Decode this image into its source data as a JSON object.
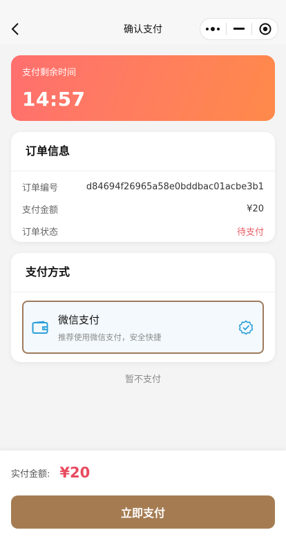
{
  "nav": {
    "title": "确认支付",
    "back_icon": "chevron-left-icon",
    "capsule_icons": [
      "more-dots-icon",
      "minimize-icon",
      "target-close-icon"
    ]
  },
  "timer": {
    "label": "支付剩余时间",
    "value": "14:57"
  },
  "order": {
    "title": "订单信息",
    "rows": [
      {
        "label": "订单编号",
        "value": "d84694f26965a58e0bddbac01acbe3b1"
      },
      {
        "label": "支付金额",
        "value": "¥20"
      },
      {
        "label": "订单状态",
        "value": "待支付"
      }
    ]
  },
  "payment": {
    "title": "支付方式",
    "option": {
      "name": "微信支付",
      "desc": "推荐使用微信支付，安全快捷",
      "icon": "wallet-icon",
      "selected_icon": "check-badge-icon"
    }
  },
  "skip_label": "暂不支付",
  "bottom": {
    "total_label": "实付金额:",
    "total_value": "¥20",
    "pay_button": "立即支付"
  },
  "colors": {
    "accent": "#a57c52",
    "price": "#e84a5f",
    "status_pending": "#e85e68",
    "timer_gradient_start": "#ff6f6f",
    "timer_gradient_end": "#ff8a4a",
    "wechat_icon": "#2a9fd8"
  }
}
